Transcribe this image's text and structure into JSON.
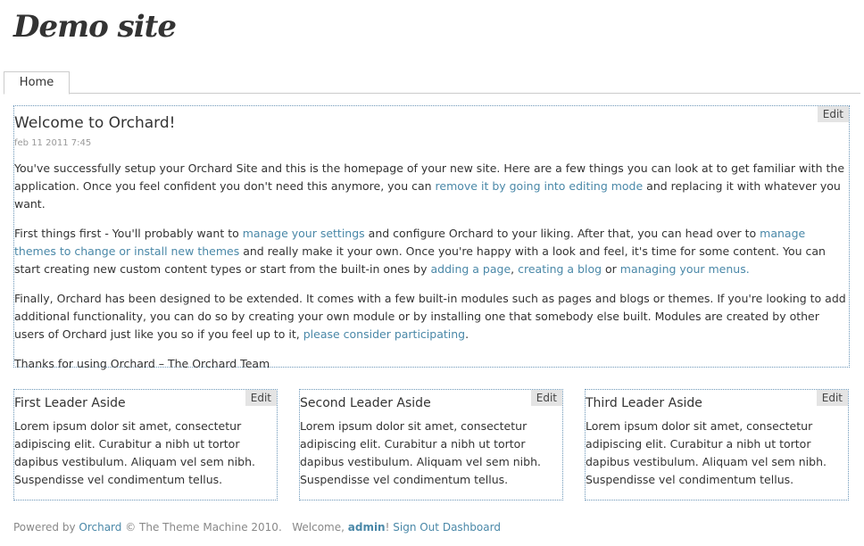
{
  "header": {
    "site_title": "Demo site"
  },
  "nav": {
    "tabs": [
      {
        "label": "Home"
      }
    ]
  },
  "main": {
    "edit_label": "Edit",
    "title": "Welcome to Orchard!",
    "date": "feb 11 2011 7:45",
    "p1": {
      "t1": "You've successfully setup your Orchard Site and this is the homepage of your new site. Here are a few things you can look at to get familiar with the application. Once you feel confident you don't need this anymore, you can ",
      "link1": "remove it by going into editing mode",
      "t2": " and replacing it with whatever you want."
    },
    "p2": {
      "t1": "First things first - You'll probably want to ",
      "link1": "manage your settings",
      "t2": " and configure Orchard to your liking. After that, you can head over to ",
      "link2": "manage themes to change or install new themes",
      "t3": " and really make it your own. Once you're happy with a look and feel, it's time for some content. You can start creating new custom content types or start from the built-in ones by ",
      "link3": "adding a page",
      "t4": ", ",
      "link4": "creating a blog",
      "t5": " or ",
      "link5": "managing your menus.",
      "t6": ""
    },
    "p3": {
      "t1": "Finally, Orchard has been designed to be extended. It comes with a few built-in modules such as pages and blogs or themes. If you're looking to add additional functionality, you can do so by creating your own module or by installing one that somebody else built. Modules are created by other users of Orchard just like you so if you feel up to it, ",
      "link1": "please consider participating",
      "t2": "."
    },
    "p4": "Thanks for using Orchard – The Orchard Team"
  },
  "asides": [
    {
      "edit_label": "Edit",
      "title": "First Leader Aside",
      "body": "Lorem ipsum dolor sit amet, consectetur adipiscing elit. Curabitur a nibh ut tortor dapibus vestibulum. Aliquam vel sem nibh. Suspendisse vel condimentum tellus."
    },
    {
      "edit_label": "Edit",
      "title": "Second Leader Aside",
      "body": "Lorem ipsum dolor sit amet, consectetur adipiscing elit. Curabitur a nibh ut tortor dapibus vestibulum. Aliquam vel sem nibh. Suspendisse vel condimentum tellus."
    },
    {
      "edit_label": "Edit",
      "title": "Third Leader Aside",
      "body": "Lorem ipsum dolor sit amet, consectetur adipiscing elit. Curabitur a nibh ut tortor dapibus vestibulum. Aliquam vel sem nibh. Suspendisse vel condimentum tellus."
    }
  ],
  "footer": {
    "powered_by": "Powered by ",
    "orchard_link": "Orchard",
    "copyright": " © The Theme Machine 2010.",
    "welcome": "Welcome, ",
    "user": "admin",
    "exclaim": "!",
    "sign_out": "Sign Out",
    "dashboard": "Dashboard"
  },
  "colors": {
    "link": "#4a88a8",
    "zone_border": "#6d97b8",
    "edit_bg": "#e4e4e4"
  }
}
